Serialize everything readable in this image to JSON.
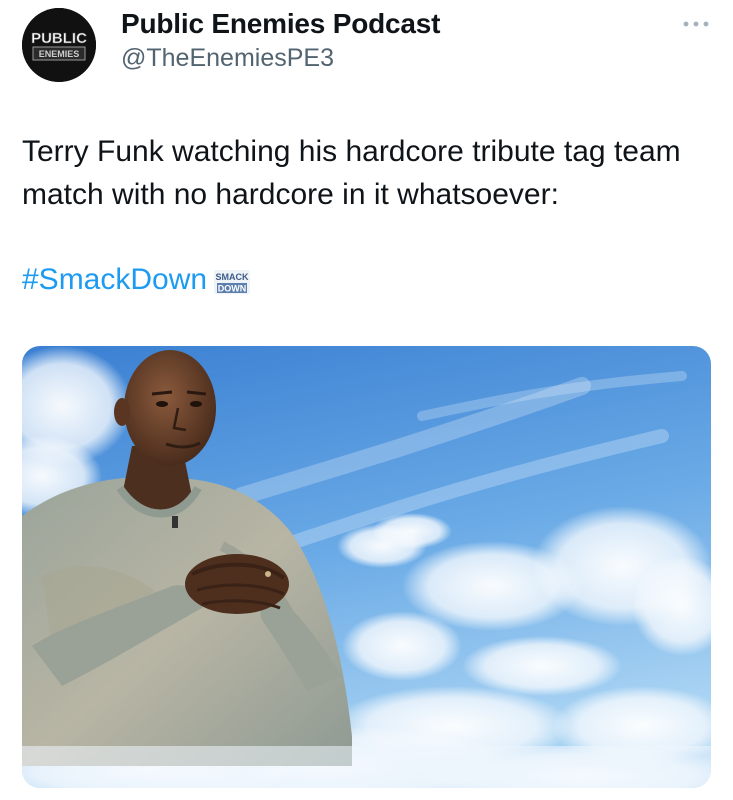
{
  "tweet": {
    "author": {
      "display_name": "Public Enemies Podcast",
      "handle": "@TheEnemiesPE3",
      "avatar_text_top": "PUBLIC",
      "avatar_text_bottom": "ENEMIES"
    },
    "menu_icon": "more-horizontal-icon",
    "text": "Terry Funk watching his hardcore tribute tag team match with no hardcore in it whatsoever:",
    "hashtag": "#SmackDown",
    "hashflag": {
      "icon": "smackdown-logo-icon",
      "text_top": "SMACK",
      "text_bottom": "DOWN"
    },
    "media": {
      "kind": "meme-image",
      "subject": "man-in-clouds"
    }
  },
  "colors": {
    "text_primary": "#0f1419",
    "text_secondary": "#536471",
    "link": "#1d9bf0",
    "sky_top": "#3f86d6",
    "sky_bottom": "#8ec3ef"
  }
}
